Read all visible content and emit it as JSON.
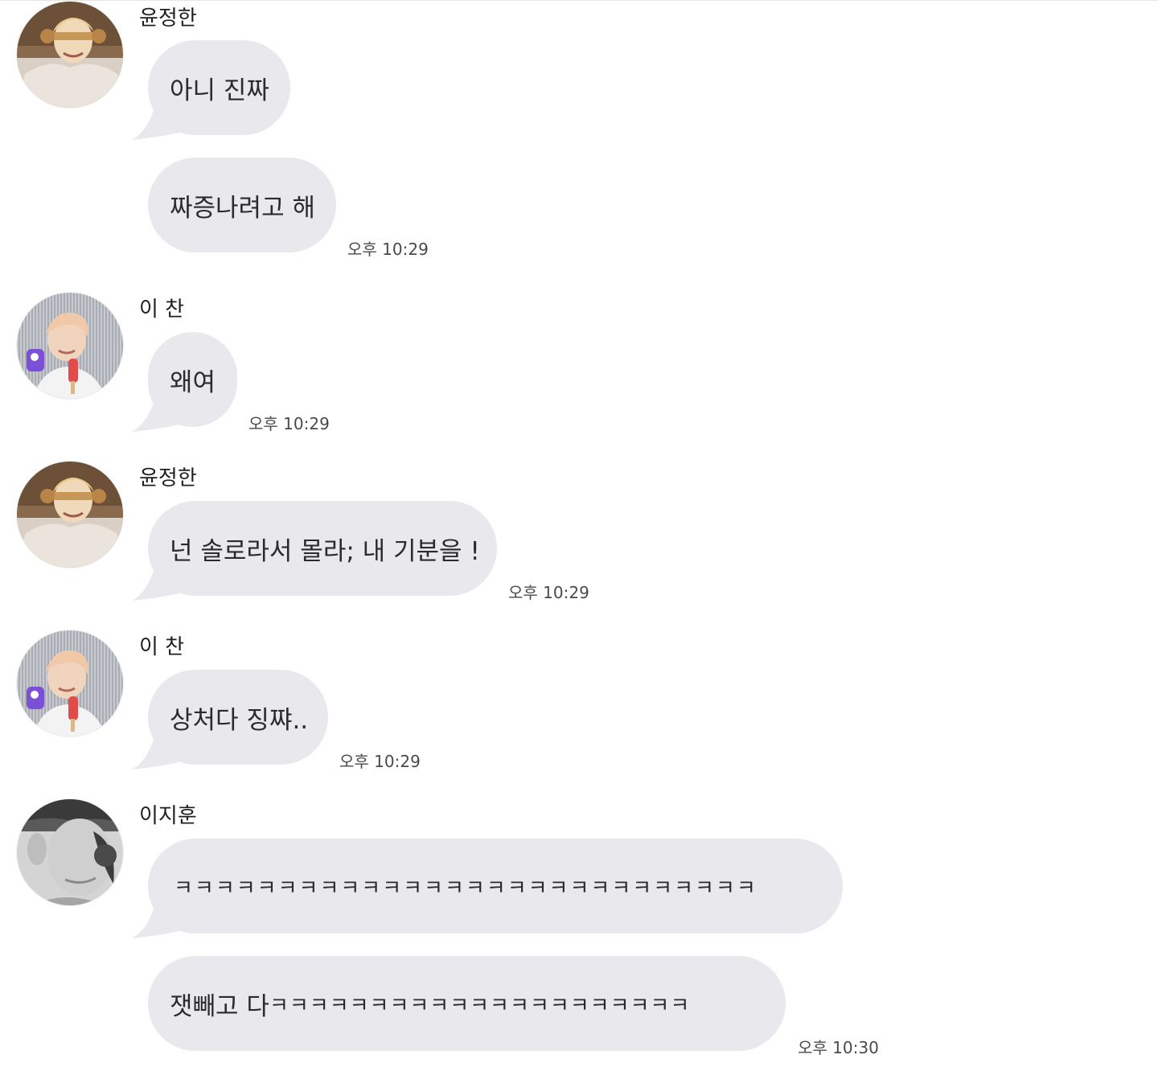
{
  "colors": {
    "background": "#ffffff",
    "bubble": "#e8e8ed",
    "sender_text": "#1f1f1f",
    "timestamp_text": "#4a4a4a"
  },
  "messages": [
    {
      "sender": "윤정한",
      "avatar_icon": "profile-photo-jeonghan",
      "bubbles": [
        "아니 진짜",
        "짜증나려고 해"
      ],
      "time": "오후 10:29"
    },
    {
      "sender": "이 찬",
      "avatar_icon": "profile-photo-chan",
      "bubbles": [
        "왜여"
      ],
      "time": "오후 10:29"
    },
    {
      "sender": "윤정한",
      "avatar_icon": "profile-photo-jeonghan",
      "bubbles": [
        "넌 솔로라서 몰라; 내 기분을 !"
      ],
      "time": "오후 10:29"
    },
    {
      "sender": "이 찬",
      "avatar_icon": "profile-photo-chan",
      "bubbles": [
        "상처다 징쨔.."
      ],
      "time": "오후 10:29"
    },
    {
      "sender": "이지훈",
      "avatar_icon": "profile-photo-jihoon",
      "bubbles": [
        "ㅋㅋㅋㅋㅋㅋㅋㅋㅋㅋㅋㅋㅋㅋㅋㅋㅋㅋㅋㅋㅋㅋㅋㅋㅋㅋㅋㅋ",
        "잿빼고 다 ",
        "ㅋㅋㅋㅋㅋㅋㅋㅋㅋㅋㅋㅋㅋㅋㅋㅋㅋㅋㅋㅋㅋ"
      ],
      "time": "오후 10:30"
    }
  ]
}
